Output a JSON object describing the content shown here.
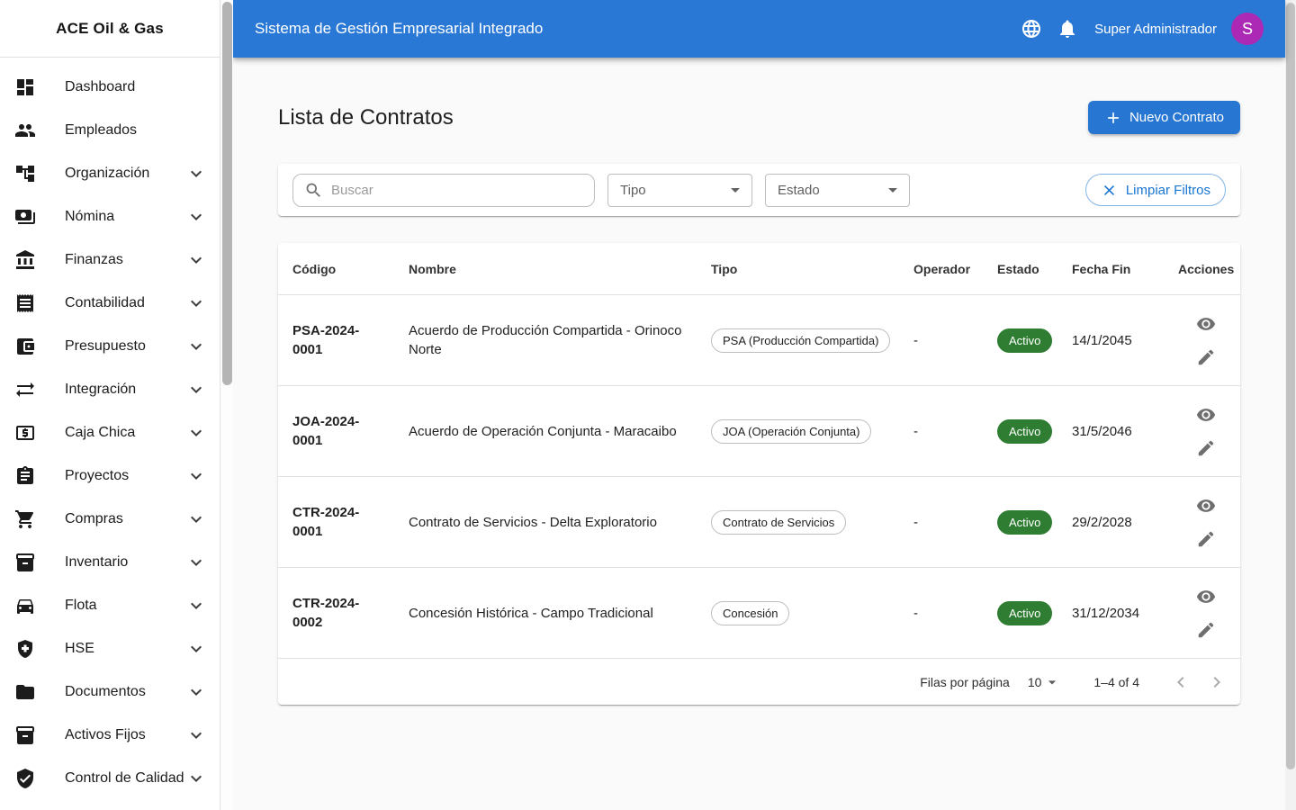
{
  "header": {
    "title": "Sistema de Gestión Empresarial Integrado",
    "user_name": "Super Administrador",
    "avatar_initial": "S"
  },
  "sidebar": {
    "brand": "ACE Oil & Gas",
    "items": [
      {
        "id": "dashboard",
        "label": "Dashboard",
        "icon": "dashboard",
        "expandable": false
      },
      {
        "id": "empleados",
        "label": "Empleados",
        "icon": "people",
        "expandable": false
      },
      {
        "id": "organizacion",
        "label": "Organización",
        "icon": "org-tree",
        "expandable": true
      },
      {
        "id": "nomina",
        "label": "Nómina",
        "icon": "payments",
        "expandable": true
      },
      {
        "id": "finanzas",
        "label": "Finanzas",
        "icon": "bank",
        "expandable": true
      },
      {
        "id": "contabilidad",
        "label": "Contabilidad",
        "icon": "receipt",
        "expandable": true
      },
      {
        "id": "presupuesto",
        "label": "Presupuesto",
        "icon": "wallet",
        "expandable": true
      },
      {
        "id": "integracion",
        "label": "Integración",
        "icon": "swap-arrows",
        "expandable": true
      },
      {
        "id": "caja-chica",
        "label": "Caja Chica",
        "icon": "cash-box",
        "expandable": true
      },
      {
        "id": "proyectos",
        "label": "Proyectos",
        "icon": "clipboard",
        "expandable": true
      },
      {
        "id": "compras",
        "label": "Compras",
        "icon": "cart",
        "expandable": true
      },
      {
        "id": "inventario",
        "label": "Inventario",
        "icon": "inventory-box",
        "expandable": true
      },
      {
        "id": "flota",
        "label": "Flota",
        "icon": "car",
        "expandable": true
      },
      {
        "id": "hse",
        "label": "HSE",
        "icon": "shield-plus",
        "expandable": true
      },
      {
        "id": "documentos",
        "label": "Documentos",
        "icon": "folder",
        "expandable": true
      },
      {
        "id": "activos-fijos",
        "label": "Activos Fijos",
        "icon": "inventory-box",
        "expandable": true
      },
      {
        "id": "control-calidad",
        "label": "Control de Calidad",
        "icon": "shield-check",
        "expandable": true
      }
    ]
  },
  "page": {
    "title": "Lista de Contratos",
    "new_contract_button": "Nuevo Contrato"
  },
  "filters": {
    "search_placeholder": "Buscar",
    "type_label": "Tipo",
    "status_label": "Estado",
    "clear_button": "Limpiar Filtros"
  },
  "table": {
    "columns": [
      "Código",
      "Nombre",
      "Tipo",
      "Operador",
      "Estado",
      "Fecha Fin",
      "Acciones"
    ],
    "rows": [
      {
        "code": "PSA-2024-0001",
        "name": "Acuerdo de Producción Compartida - Orinoco Norte",
        "type": "PSA (Producción Compartida)",
        "operator": "-",
        "status": "Activo",
        "end_date": "14/1/2045"
      },
      {
        "code": "JOA-2024-0001",
        "name": "Acuerdo de Operación Conjunta - Maracaibo",
        "type": "JOA (Operación Conjunta)",
        "operator": "-",
        "status": "Activo",
        "end_date": "31/5/2046"
      },
      {
        "code": "CTR-2024-0001",
        "name": "Contrato de Servicios - Delta Exploratorio",
        "type": "Contrato de Servicios",
        "operator": "-",
        "status": "Activo",
        "end_date": "29/2/2028"
      },
      {
        "code": "CTR-2024-0002",
        "name": "Concesión Histórica - Campo Tradicional",
        "type": "Concesión",
        "operator": "-",
        "status": "Activo",
        "end_date": "31/12/2034"
      }
    ]
  },
  "pagination": {
    "rows_per_page_label": "Filas por página",
    "rows_per_page_value": "10",
    "range_label": "1–4 of 4"
  },
  "colors": {
    "header_blue": "#2a78d5",
    "button_blue": "#2676d2",
    "link_blue": "#1976d2",
    "status_green": "#2e7d32",
    "avatar_purple": "#ab29b4"
  }
}
